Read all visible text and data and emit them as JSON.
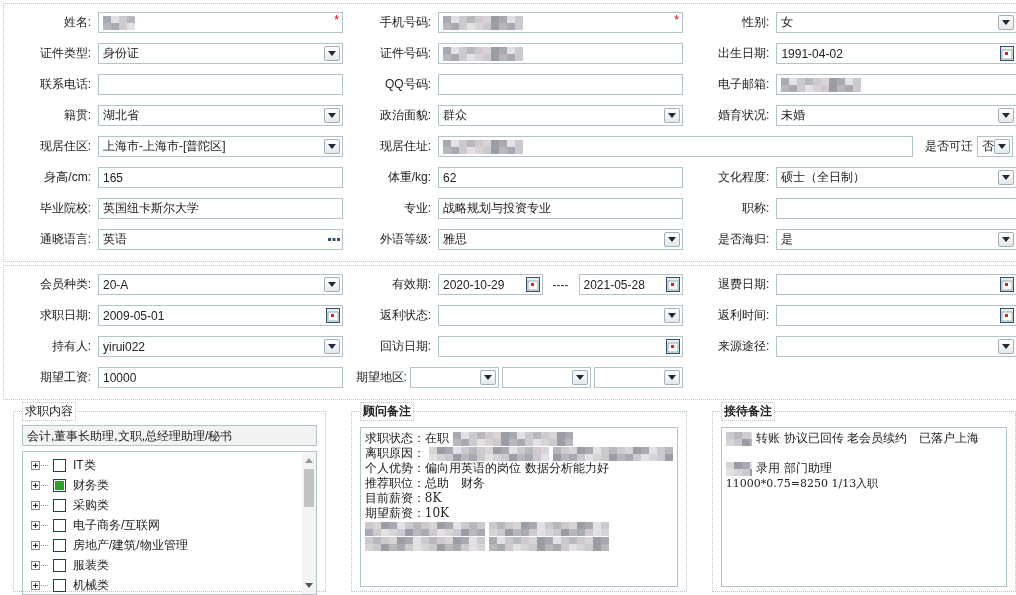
{
  "form_sections": [
    {
      "rows": [
        [
          {
            "label": "姓名:",
            "kind": "normal",
            "fields": [
              {
                "kind": "text",
                "redacted": true,
                "required_mark": "*"
              }
            ]
          },
          {
            "label": "手机号码:",
            "kind": "normal",
            "fields": [
              {
                "kind": "text",
                "redacted": true,
                "required_mark": "*"
              }
            ]
          },
          {
            "label": "性别:",
            "kind": "normal",
            "fields": [
              {
                "kind": "select",
                "value": "女"
              }
            ]
          }
        ],
        [
          {
            "label": "证件类型:",
            "kind": "normal",
            "fields": [
              {
                "kind": "select",
                "value": "身份证"
              }
            ]
          },
          {
            "label": "证件号码:",
            "kind": "normal",
            "fields": [
              {
                "kind": "text",
                "redacted": true
              }
            ]
          },
          {
            "label": "出生日期:",
            "kind": "normal",
            "fields": [
              {
                "kind": "date",
                "value": "1991-04-02"
              }
            ]
          }
        ],
        [
          {
            "label": "联系电话:",
            "kind": "normal",
            "fields": [
              {
                "kind": "text"
              }
            ]
          },
          {
            "label": "QQ号码:",
            "kind": "normal",
            "fields": [
              {
                "kind": "text"
              }
            ]
          },
          {
            "label": "电子邮箱:",
            "kind": "normal",
            "fields": [
              {
                "kind": "text",
                "redacted": true
              }
            ]
          }
        ],
        [
          {
            "label": "籍贯:",
            "kind": "normal",
            "fields": [
              {
                "kind": "select",
                "value": "湖北省"
              }
            ]
          },
          {
            "label": "政治面貌:",
            "kind": "normal",
            "fields": [
              {
                "kind": "select",
                "value": "群众"
              }
            ]
          },
          {
            "label": "婚育状况:",
            "kind": "normal",
            "fields": [
              {
                "kind": "select",
                "value": "未婚"
              }
            ]
          }
        ],
        [
          {
            "label": "现居住区:",
            "kind": "normal",
            "fields": [
              {
                "kind": "select",
                "value": "上海市-上海市-[普陀区]"
              }
            ]
          },
          {
            "label": "现居住址:",
            "kind": "wide",
            "fields": [
              {
                "kind": "text",
                "redacted": true
              }
            ]
          },
          {
            "label": "是否可迁",
            "kind": "compact",
            "fields": [
              {
                "kind": "select",
                "value": "否"
              }
            ]
          }
        ],
        [
          {
            "label": "身高/cm:",
            "kind": "normal",
            "fields": [
              {
                "kind": "text",
                "value": "165"
              }
            ]
          },
          {
            "label": "体重/kg:",
            "kind": "normal",
            "fields": [
              {
                "kind": "text",
                "value": "62"
              }
            ]
          },
          {
            "label": "文化程度:",
            "kind": "normal",
            "fields": [
              {
                "kind": "select",
                "value": "硕士（全日制）"
              }
            ]
          }
        ],
        [
          {
            "label": "毕业院校:",
            "kind": "normal",
            "fields": [
              {
                "kind": "text",
                "value": "英国纽卡斯尔大学"
              }
            ]
          },
          {
            "label": "专业:",
            "kind": "normal",
            "fields": [
              {
                "kind": "text",
                "value": "战略规划与投资专业"
              }
            ]
          },
          {
            "label": "职称:",
            "kind": "normal",
            "fields": [
              {
                "kind": "text"
              }
            ]
          }
        ],
        [
          {
            "label": "通晓语言:",
            "kind": "normal",
            "fields": [
              {
                "kind": "more",
                "value": "英语"
              }
            ]
          },
          {
            "label": "外语等级:",
            "kind": "normal",
            "fields": [
              {
                "kind": "select",
                "value": "雅思"
              }
            ]
          },
          {
            "label": "是否海归:",
            "kind": "normal",
            "fields": [
              {
                "kind": "select",
                "value": "是"
              }
            ]
          }
        ]
      ]
    },
    {
      "rows": [
        [
          {
            "label": "会员种类:",
            "kind": "normal",
            "fields": [
              {
                "kind": "select",
                "value": "20-A"
              }
            ]
          },
          {
            "label": "有效期:",
            "kind": "normal",
            "fields": [
              {
                "kind": "date",
                "value": "2020-10-29"
              },
              {
                "kind": "separator",
                "value": "----"
              },
              {
                "kind": "date",
                "value": "2021-05-28"
              }
            ]
          },
          {
            "label": "退费日期:",
            "kind": "normal",
            "fields": [
              {
                "kind": "date"
              }
            ]
          }
        ],
        [
          {
            "label": "求职日期:",
            "kind": "normal",
            "fields": [
              {
                "kind": "date",
                "value": "2009-05-01"
              }
            ]
          },
          {
            "label": "返利状态:",
            "kind": "normal",
            "fields": [
              {
                "kind": "select"
              }
            ]
          },
          {
            "label": "返利时间:",
            "kind": "normal",
            "fields": [
              {
                "kind": "date"
              }
            ]
          }
        ],
        [
          {
            "label": "持有人:",
            "kind": "normal",
            "fields": [
              {
                "kind": "select",
                "value": "yirui022"
              }
            ]
          },
          {
            "label": "回访日期:",
            "kind": "normal",
            "fields": [
              {
                "kind": "date"
              }
            ]
          },
          {
            "label": "来源途径:",
            "kind": "normal",
            "fields": [
              {
                "kind": "select"
              }
            ]
          }
        ],
        [
          {
            "label": "期望工资:",
            "kind": "normal",
            "fields": [
              {
                "kind": "text",
                "value": "10000"
              }
            ]
          },
          {
            "label": "期望地区:",
            "kind": "multi",
            "fields": [
              {
                "kind": "select"
              },
              {
                "kind": "select"
              },
              {
                "kind": "select"
              }
            ]
          }
        ]
      ]
    }
  ],
  "job_intent": {
    "title": "求职内容",
    "summary": "会计,董事长助理,文职,总经理助理/秘书",
    "categories": [
      {
        "label": "IT类",
        "checked": false,
        "expanded": false
      },
      {
        "label": "财务类",
        "checked": true,
        "expanded": false
      },
      {
        "label": "采购类",
        "checked": false,
        "expanded": false
      },
      {
        "label": "电子商务/互联网",
        "checked": false,
        "expanded": false
      },
      {
        "label": "房地产/建筑/物业管理",
        "checked": false,
        "expanded": false
      },
      {
        "label": "服装类",
        "checked": false,
        "expanded": false
      },
      {
        "label": "机械类",
        "checked": false,
        "expanded": false
      }
    ]
  },
  "notes": [
    {
      "title": "顾问备注",
      "lines": [
        {
          "parts": [
            {
              "kind": "text",
              "text": "求职状态：在职"
            },
            {
              "kind": "blur"
            }
          ]
        },
        {
          "parts": [
            {
              "kind": "text",
              "text": "离职原因："
            },
            {
              "kind": "blur"
            },
            {
              "kind": "blur"
            }
          ]
        },
        {
          "parts": [
            {
              "kind": "text",
              "text": "个人优势：偏向用英语的岗位 数据分析能力好"
            }
          ]
        },
        {
          "parts": [
            {
              "kind": "text",
              "text": "推荐职位：总助　财务"
            }
          ]
        },
        {
          "parts": [
            {
              "kind": "text",
              "text": "目前薪资：8K"
            }
          ]
        },
        {
          "parts": [
            {
              "kind": "text",
              "text": "期望薪资：10K"
            }
          ]
        },
        {
          "parts": [
            {
              "kind": "blur"
            },
            {
              "kind": "blur"
            }
          ]
        },
        {
          "parts": [
            {
              "kind": "blur"
            },
            {
              "kind": "blur"
            }
          ]
        }
      ]
    },
    {
      "title": "接待备注",
      "lines": [
        {
          "parts": [
            {
              "kind": "blur"
            },
            {
              "kind": "text",
              "text": "转账 协议已回传 老会员续约　已落户上海"
            }
          ]
        },
        {
          "parts": [
            {
              "kind": "blank"
            }
          ]
        },
        {
          "parts": [
            {
              "kind": "blur"
            },
            {
              "kind": "text",
              "text": "录用 部门助理"
            }
          ]
        },
        {
          "parts": [
            {
              "kind": "small",
              "text": "11000*0.75=8250  1/13入职"
            }
          ]
        }
      ]
    }
  ]
}
